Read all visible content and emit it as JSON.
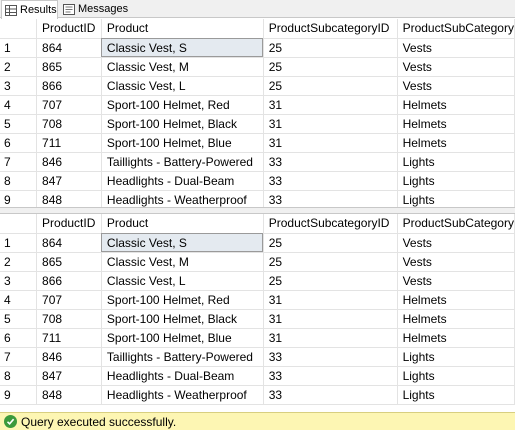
{
  "tabs": [
    {
      "label": "Results",
      "icon": "grid-icon",
      "active": true
    },
    {
      "label": "Messages",
      "icon": "messages-icon",
      "active": false
    }
  ],
  "grids": [
    {
      "columns": [
        "",
        "ProductID",
        "Product",
        "ProductSubcategoryID",
        "ProductSubCategory"
      ],
      "rows": [
        [
          "1",
          "864",
          "Classic Vest, S",
          "25",
          "Vests"
        ],
        [
          "2",
          "865",
          "Classic Vest, M",
          "25",
          "Vests"
        ],
        [
          "3",
          "866",
          "Classic Vest, L",
          "25",
          "Vests"
        ],
        [
          "4",
          "707",
          "Sport-100 Helmet, Red",
          "31",
          "Helmets"
        ],
        [
          "5",
          "708",
          "Sport-100 Helmet, Black",
          "31",
          "Helmets"
        ],
        [
          "6",
          "711",
          "Sport-100 Helmet, Blue",
          "31",
          "Helmets"
        ],
        [
          "7",
          "846",
          "Taillights - Battery-Powered",
          "33",
          "Lights"
        ],
        [
          "8",
          "847",
          "Headlights - Dual-Beam",
          "33",
          "Lights"
        ],
        [
          "9",
          "848",
          "Headlights - Weatherproof",
          "33",
          "Lights"
        ]
      ]
    },
    {
      "columns": [
        "",
        "ProductID",
        "Product",
        "ProductSubcategoryID",
        "ProductSubCategory"
      ],
      "rows": [
        [
          "1",
          "864",
          "Classic Vest, S",
          "25",
          "Vests"
        ],
        [
          "2",
          "865",
          "Classic Vest, M",
          "25",
          "Vests"
        ],
        [
          "3",
          "866",
          "Classic Vest, L",
          "25",
          "Vests"
        ],
        [
          "4",
          "707",
          "Sport-100 Helmet, Red",
          "31",
          "Helmets"
        ],
        [
          "5",
          "708",
          "Sport-100 Helmet, Black",
          "31",
          "Helmets"
        ],
        [
          "6",
          "711",
          "Sport-100 Helmet, Blue",
          "31",
          "Helmets"
        ],
        [
          "7",
          "846",
          "Taillights - Battery-Powered",
          "33",
          "Lights"
        ],
        [
          "8",
          "847",
          "Headlights - Dual-Beam",
          "33",
          "Lights"
        ],
        [
          "9",
          "848",
          "Headlights - Weatherproof",
          "33",
          "Lights"
        ]
      ]
    }
  ],
  "status": {
    "text": "Query executed successfully.",
    "icon": "check-circle-icon",
    "color": "#fdf6b3"
  }
}
